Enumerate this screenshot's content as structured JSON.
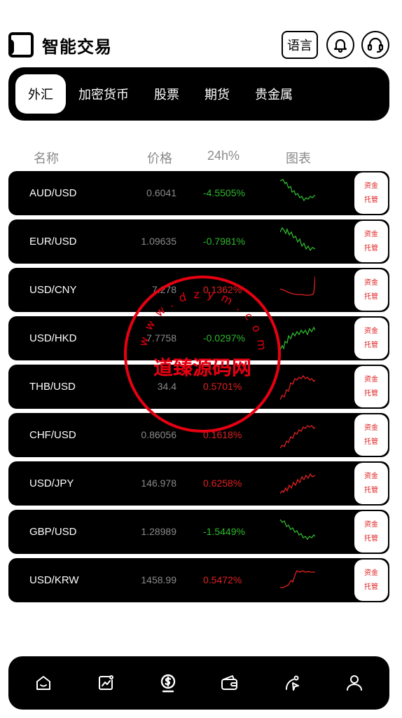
{
  "header": {
    "title": "智能交易",
    "lang_label": "语言",
    "icons": [
      "app-logo-icon",
      "bell-icon",
      "headset-icon"
    ]
  },
  "tabs": [
    {
      "label": "外汇",
      "active": true
    },
    {
      "label": "加密货币",
      "active": false
    },
    {
      "label": "股票",
      "active": false
    },
    {
      "label": "期货",
      "active": false
    },
    {
      "label": "贵金属",
      "active": false
    }
  ],
  "columns": {
    "name": "名称",
    "price": "价格",
    "change": "24h%",
    "chart": "图表"
  },
  "custody": {
    "line1": "资金",
    "line2": "托管"
  },
  "colors": {
    "up": "#e02020",
    "down": "#2eb82e",
    "panel": "#000000"
  },
  "rows": [
    {
      "symbol": "AUD/USD",
      "price": "0.6041",
      "change": "-4.5505%",
      "trend": "down"
    },
    {
      "symbol": "EUR/USD",
      "price": "1.09635",
      "change": "-0.7981%",
      "trend": "down"
    },
    {
      "symbol": "USD/CNY",
      "price": "7.278",
      "change": "0.1362%",
      "trend": "up"
    },
    {
      "symbol": "USD/HKD",
      "price": "7.7758",
      "change": "-0.0297%",
      "trend": "down"
    },
    {
      "symbol": "THB/USD",
      "price": "34.4",
      "change": "0.5701%",
      "trend": "up"
    },
    {
      "symbol": "CHF/USD",
      "price": "0.86056",
      "change": "0.1618%",
      "trend": "up"
    },
    {
      "symbol": "USD/JPY",
      "price": "146.978",
      "change": "0.6258%",
      "trend": "up"
    },
    {
      "symbol": "GBP/USD",
      "price": "1.28989",
      "change": "-1.5449%",
      "trend": "down"
    },
    {
      "symbol": "USD/KRW",
      "price": "1458.99",
      "change": "0.5472%",
      "trend": "up"
    }
  ],
  "watermark": {
    "text": "道臻源码网",
    "ring_text": "www.dzym.com"
  },
  "bottom_nav": [
    {
      "icon": "home-icon"
    },
    {
      "icon": "market-chart-icon"
    },
    {
      "icon": "trade-dollar-icon",
      "active": true
    },
    {
      "icon": "wallet-icon"
    },
    {
      "icon": "discover-icon"
    },
    {
      "icon": "profile-icon"
    }
  ]
}
